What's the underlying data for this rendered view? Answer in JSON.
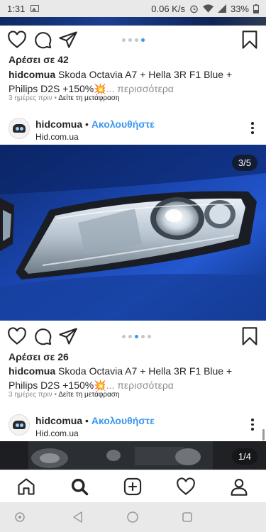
{
  "status_bar": {
    "time": "1:31",
    "speed": "0.06 K/s",
    "battery": "33%"
  },
  "posts": [
    {
      "likes": "Αρέσει σε 42",
      "user": "hidcomua",
      "caption": " Skoda Octavia A7 + Hella 3R F1 Blue + Philips D2S +150%💥",
      "more": "... περισσότερα",
      "time_ago": "3 ημέρες πριν",
      "meta_sep": " • ",
      "translate": "Δείτε τη μετάφραση"
    },
    {
      "header_user": "hidcomua",
      "header_sep": " • ",
      "follow": "Ακολουθήστε",
      "location": "Hid.com.ua",
      "counter": "3/5",
      "likes": "Αρέσει σε 26",
      "user": "hidcomua",
      "caption": " Skoda Octavia A7 + Hella 3R F1 Blue + Philips D2S +150%💥",
      "more": "... περισσότερα",
      "time_ago": "3 ημέρες πριν",
      "meta_sep": " • ",
      "translate": "Δείτε τη μετάφραση"
    },
    {
      "header_user": "hidcomua",
      "header_sep": " • ",
      "follow": "Ακολουθήστε",
      "location": "Hid.com.ua",
      "counter": "1/4"
    }
  ],
  "bottom_nav": [
    "home-icon",
    "search-icon",
    "new-post-icon",
    "activity-heart-icon",
    "profile-icon"
  ],
  "colors": {
    "accent": "#3897f0",
    "text": "#262626",
    "muted": "#8e8e8e"
  }
}
